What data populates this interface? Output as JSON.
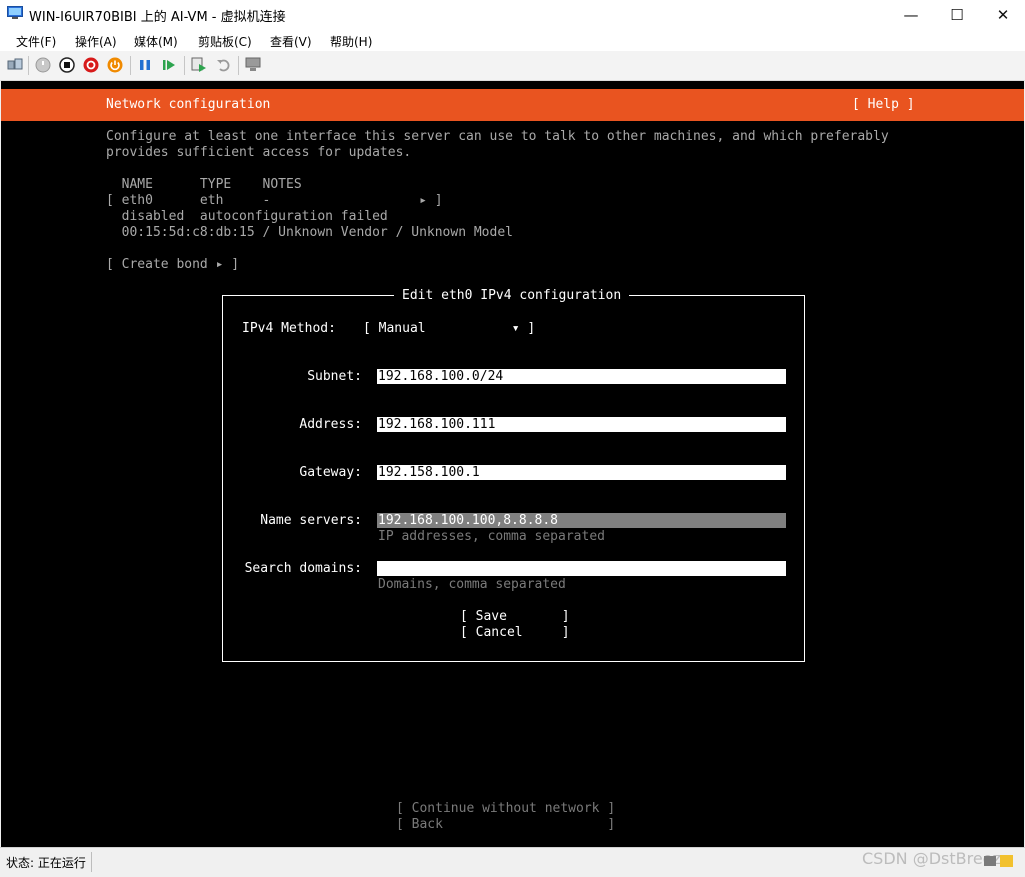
{
  "window": {
    "title": "WIN-I6UIR70BIBI 上的 AI-VM - 虚拟机连接",
    "minimize_glyph": "—",
    "maximize_glyph": "☐",
    "close_glyph": "✕"
  },
  "menu": {
    "items": [
      "文件(F)",
      "操作(A)",
      "媒体(M)",
      "剪贴板(C)",
      "查看(V)",
      "帮助(H)"
    ]
  },
  "toolbar": {
    "icons": [
      "ctrl-alt-del-icon",
      "start-icon",
      "turn-off-icon",
      "shutdown-icon",
      "power-icon",
      "pause-icon",
      "resume-icon",
      "checkpoint-icon",
      "revert-icon",
      "enhanced-session-icon"
    ],
    "colors": {
      "red": "#d71a1a",
      "orange": "#f08a00",
      "blue": "#1f6fd1",
      "green": "#2da44e"
    }
  },
  "installer": {
    "header_title": "Network configuration",
    "help_label": "[ Help ]",
    "intro_line1": "Configure at least one interface this server can use to talk to other machines, and which preferably",
    "intro_line2": "provides sufficient access for updates.",
    "table_header": "  NAME      TYPE    NOTES",
    "row_line": "[ eth0      eth     -                   ▸ ]",
    "row_status": "  disabled  autoconfiguration failed",
    "row_mac": "  00:15:5d:c8:db:15 / Unknown Vendor / Unknown Model",
    "create_bond": "[ Create bond ▸ ]",
    "accent_color": "#e95420",
    "dialog": {
      "title": "Edit eth0 IPv4 configuration",
      "method_label": "IPv4 Method:",
      "method_value": "[ Manual           ▾ ]",
      "subnet_label": "Subnet:",
      "subnet_value": "192.168.100.0/24",
      "address_label": "Address:",
      "address_value": "192.168.100.111",
      "gateway_label": "Gateway:",
      "gateway_value": "192.158.100.1",
      "nameservers_label": "Name servers:",
      "nameservers_value": "192.168.100.100,8.8.8.8",
      "nameservers_hint": "IP addresses, comma separated",
      "searchdomains_label": "Search domains:",
      "searchdomains_value": "",
      "searchdomains_hint": "Domains, comma separated",
      "save_label": "[ Save       ]",
      "cancel_label": "[ Cancel     ]"
    },
    "continue_label": "[ Continue without network ]",
    "back_label": "[ Back                     ]"
  },
  "status": {
    "text": "状态: 正在运行"
  },
  "watermark": "CSDN @DstBreeze"
}
